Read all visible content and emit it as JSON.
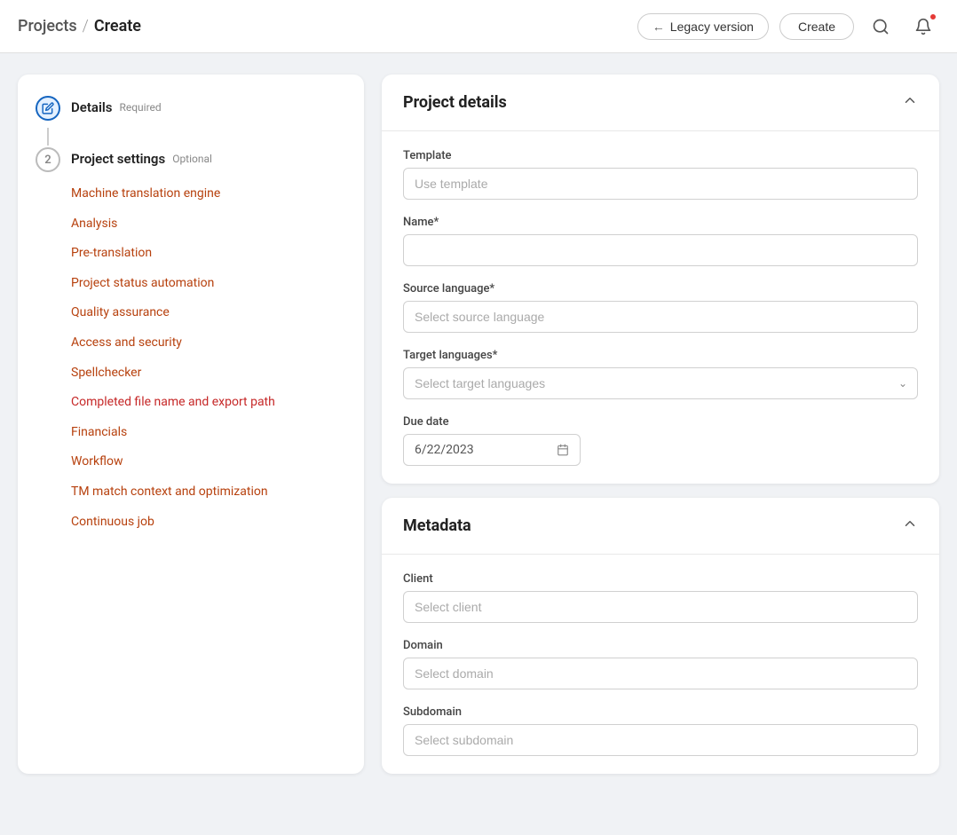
{
  "header": {
    "breadcrumb_projects": "Projects",
    "breadcrumb_separator": "/",
    "breadcrumb_create": "Create",
    "legacy_button_label": "Legacy version",
    "create_button_label": "Create",
    "search_icon": "🔍",
    "notification_icon": "🔔"
  },
  "sidebar": {
    "step1": {
      "label": "Details",
      "badge": "Required"
    },
    "step2": {
      "label": "Project settings",
      "badge": "Optional"
    },
    "sub_items": [
      "Machine translation engine",
      "Analysis",
      "Pre-translation",
      "Project status automation",
      "Quality assurance",
      "Access and security",
      "Spellchecker",
      "Completed file name and export path",
      "Financials",
      "Workflow",
      "TM match context and optimization",
      "Continuous job"
    ]
  },
  "project_details_card": {
    "title": "Project details",
    "fields": {
      "template_label": "Template",
      "template_placeholder": "Use template",
      "name_label": "Name*",
      "name_placeholder": "",
      "source_language_label": "Source language*",
      "source_language_placeholder": "Select source language",
      "target_languages_label": "Target languages*",
      "target_languages_placeholder": "Select target languages",
      "due_date_label": "Due date",
      "due_date_value": "6/22/2023"
    }
  },
  "metadata_card": {
    "title": "Metadata",
    "fields": {
      "client_label": "Client",
      "client_placeholder": "Select client",
      "domain_label": "Domain",
      "domain_placeholder": "Select domain",
      "subdomain_label": "Subdomain",
      "subdomain_placeholder": "Select subdomain"
    }
  }
}
